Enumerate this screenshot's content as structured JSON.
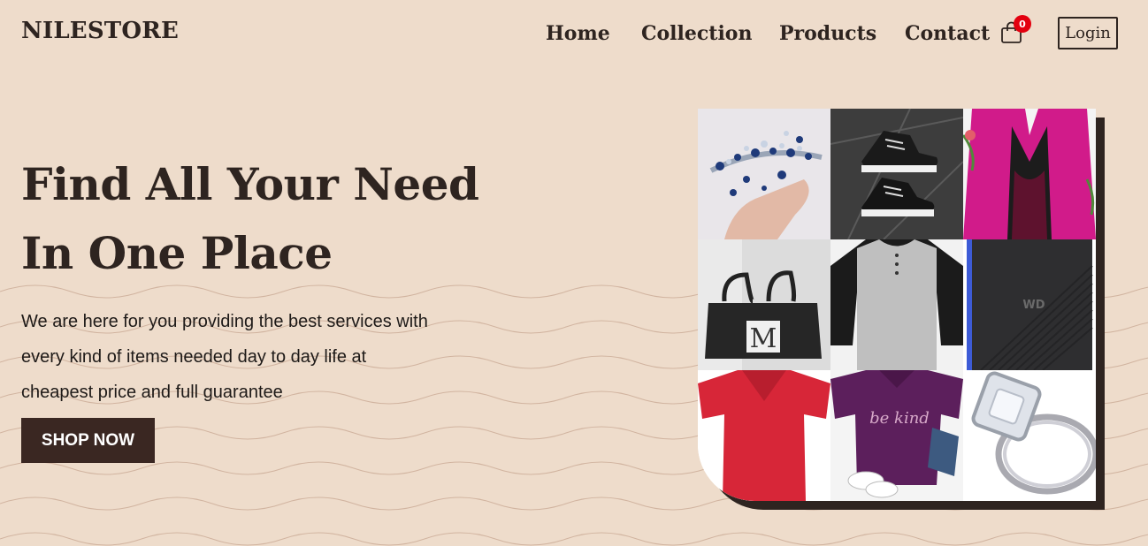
{
  "brand": {
    "name": "NILESTORE"
  },
  "nav": {
    "links": [
      {
        "label": "Home"
      },
      {
        "label": "Collection"
      },
      {
        "label": "Products"
      },
      {
        "label": "Contact"
      }
    ],
    "cart": {
      "icon": "shopping-bag-icon",
      "count": "0",
      "badge_color": "#e3000f"
    },
    "login_label": "Login"
  },
  "hero": {
    "title_line1": "Find All Your Need",
    "title_line2": "In One Place",
    "text_line1": "We are here for you providing the best services with",
    "text_line2": "every kind of items needed day to day life at",
    "text_line3": "cheapest price and full guarantee",
    "cta_label": "SHOP NOW"
  },
  "collage": {
    "tiles": [
      "jewelry-tiara-image",
      "converse-sneakers-image",
      "pink-blazer-image",
      "black-bag-image",
      "raglan-shirt-image",
      "wd-hard-drive-image",
      "red-tshirt-image",
      "purple-be-kind-tshirt-image",
      "diamond-rings-image"
    ],
    "tshirt_print": "be kind",
    "drive_logo": "WD"
  },
  "colors": {
    "background": "#eedccb",
    "text_dark": "#2e2420",
    "button_bg": "#3a2722",
    "button_text": "#ffffff"
  }
}
